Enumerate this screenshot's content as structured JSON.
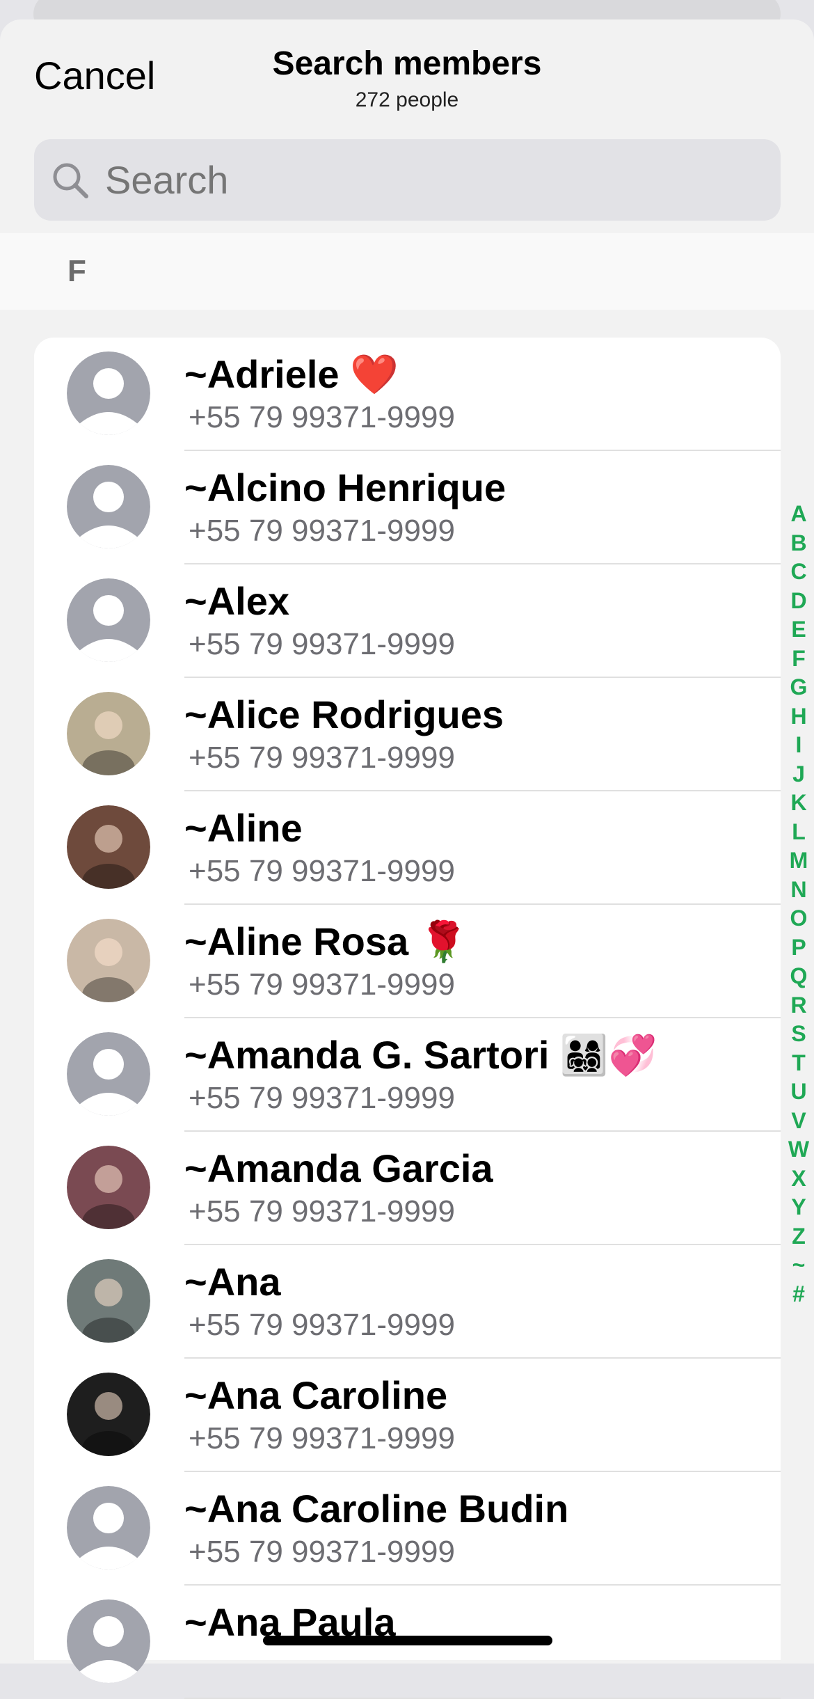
{
  "header": {
    "cancel_label": "Cancel",
    "title": "Search members",
    "subtitle": "272 people"
  },
  "search": {
    "placeholder": "Search"
  },
  "section": {
    "letter": "F"
  },
  "members": [
    {
      "name": "~Adriele ❤️",
      "phone": "+55 79 99371-9999",
      "avatar": "placeholder"
    },
    {
      "name": "~Alcino Henrique",
      "phone": "+55 79 99371-9999",
      "avatar": "placeholder"
    },
    {
      "name": "~Alex",
      "phone": "+55 79 99371-9999",
      "avatar": "placeholder"
    },
    {
      "name": "~Alice Rodrigues",
      "phone": "+55 79 99371-9999",
      "avatar": "photo",
      "color": "#b9ad92"
    },
    {
      "name": "~Aline",
      "phone": "+55 79 99371-9999",
      "avatar": "photo",
      "color": "#6e4a3c"
    },
    {
      "name": "~Aline Rosa 🌹",
      "phone": "+55 79 99371-9999",
      "avatar": "photo",
      "color": "#c9b8a6"
    },
    {
      "name": "~Amanda G. Sartori 👨‍👩‍👧‍👦💞",
      "phone": "+55 79 99371-9999",
      "avatar": "placeholder"
    },
    {
      "name": "~Amanda Garcia",
      "phone": "+55 79 99371-9999",
      "avatar": "photo",
      "color": "#7a4a52"
    },
    {
      "name": "~Ana",
      "phone": "+55 79 99371-9999",
      "avatar": "photo",
      "color": "#6f7a78"
    },
    {
      "name": "~Ana Caroline",
      "phone": "+55 79 99371-9999",
      "avatar": "photo",
      "color": "#1e1e1e"
    },
    {
      "name": "~Ana Caroline Budin",
      "phone": "+55 79 99371-9999",
      "avatar": "placeholder"
    },
    {
      "name": "~Ana Paula",
      "phone": "",
      "avatar": "placeholder"
    }
  ],
  "index_letters": [
    "A",
    "B",
    "C",
    "D",
    "E",
    "F",
    "G",
    "H",
    "I",
    "J",
    "K",
    "L",
    "M",
    "N",
    "O",
    "P",
    "Q",
    "R",
    "S",
    "T",
    "U",
    "V",
    "W",
    "X",
    "Y",
    "Z",
    "~",
    "#"
  ],
  "colors": {
    "accent": "#1fa855",
    "placeholder_avatar": "#a2a4ad",
    "sheet_background": "#f2f2f2"
  }
}
